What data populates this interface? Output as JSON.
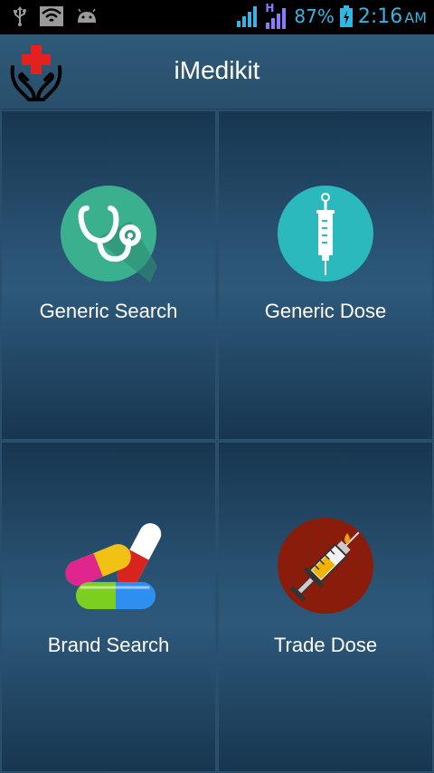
{
  "status_bar": {
    "icons": [
      "usb-icon",
      "wifi-icon",
      "android-icon",
      "signal-icon",
      "hspa-signal-icon",
      "battery-icon"
    ],
    "network_type": "H",
    "battery": "87%",
    "time": "2:16",
    "ampm": "AM",
    "color": "#33b5e5"
  },
  "app_bar": {
    "title": "iMedikit",
    "logo_icon": "medical-cross-hands-icon"
  },
  "menu": [
    {
      "label": "Generic Search",
      "icon": "stethoscope-icon",
      "icon_bg": "#3bb08f"
    },
    {
      "label": "Generic Dose",
      "icon": "syringe-icon",
      "icon_bg": "#2bb9bd"
    },
    {
      "label": "Brand Search",
      "icon": "pills-icon"
    },
    {
      "label": "Trade Dose",
      "icon": "injection-icon",
      "icon_bg": "#8a1c0c"
    }
  ]
}
